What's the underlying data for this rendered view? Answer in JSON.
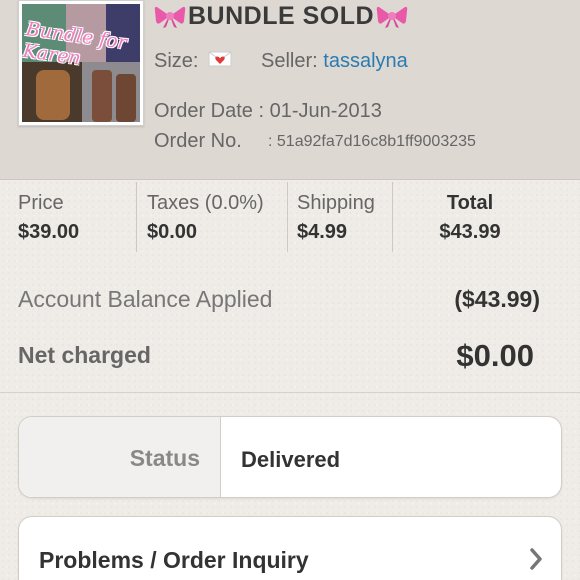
{
  "listing": {
    "thumbnail_caption": "Bundle for Karen",
    "title": "BUNDLE SOLD",
    "size_label": "Size:",
    "size_icon": "envelope-heart-icon",
    "seller_label": "Seller:",
    "seller_name": "tassalyna",
    "order_date_label": "Order Date : 01-Jun-2013",
    "order_no_label": "Order No.",
    "order_no_value": ": 51a92fa7d16c8b1ff9003235"
  },
  "summary": {
    "price_label": "Price",
    "price_value": "$39.00",
    "taxes_label": "Taxes (0.0%)",
    "taxes_value": "$0.00",
    "shipping_label": "Shipping",
    "shipping_value": "$4.99",
    "total_label": "Total",
    "total_value": "$43.99"
  },
  "balance": {
    "applied_label": "Account Balance Applied",
    "applied_value": "($43.99)",
    "net_label": "Net charged",
    "net_value": "$0.00"
  },
  "status": {
    "label": "Status",
    "value": "Delivered"
  },
  "inquiry": {
    "label": "Problems / Order Inquiry"
  },
  "colors": {
    "header_bg": "#ded8d3",
    "page_bg": "#efebe6",
    "link": "#2b7bb0",
    "bow_pink": "#e85aa8"
  }
}
